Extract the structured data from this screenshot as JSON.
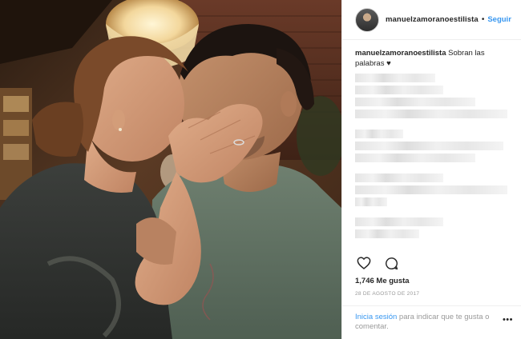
{
  "post": {
    "username": "manuelzamoranoestilista",
    "follow_label": "Seguir",
    "separator": "•",
    "caption_user": "manuelzamoranoestilista",
    "caption_text": "Sobran las palabras ♥",
    "likes": "1,746 Me gusta",
    "date": "28 DE AGOSTO DE 2017",
    "login_link": "Inicia sesión",
    "login_rest": "para indicar que te gusta o comentar.",
    "more": "•••"
  },
  "icons": {
    "like": "heart-outline-icon",
    "comment": "comment-bubble-icon",
    "more": "more-options-icon"
  },
  "colors": {
    "link_blue": "#3897f0",
    "text": "#262626",
    "muted": "#999999",
    "border": "#efefef"
  }
}
